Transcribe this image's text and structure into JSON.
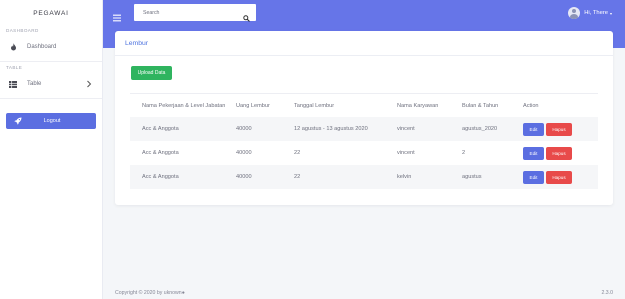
{
  "sidebar": {
    "brand": "PEGAWAI",
    "heading_dashboard": "DASHBOARD",
    "dashboard_label": "Dashboard",
    "heading_table": "TABLE",
    "table_label": "Table",
    "logout_label": "Logout"
  },
  "topbar": {
    "search_placeholder": "Search",
    "user_name": "Hi, There",
    "caret": "▾"
  },
  "card": {
    "title": "Lembur",
    "upload_label": "Upload Data"
  },
  "table": {
    "headers": [
      "Nama Pekerjaan & Level Jabatan",
      "Uang Lembur",
      "Tanggal Lembur",
      "Nama Karyawan",
      "Bulan & Tahun",
      "Action"
    ],
    "rows": [
      [
        "Acc & Anggota",
        "40000",
        "12 agustus - 13 agustus 2020",
        "vincent",
        "agustus_2020"
      ],
      [
        "Acc & Anggota",
        "40000",
        "22",
        "vincent",
        "2"
      ],
      [
        "Acc & Anggota",
        "40000",
        "22",
        "kelvin",
        "agustus"
      ]
    ],
    "edit_label": "Edit",
    "delete_label": "Hapus"
  },
  "footer": {
    "copyright": "Copyright © 2020  by uknown●",
    "version": "2.3.0"
  },
  "colors": {
    "topbar": "#6675e8",
    "primary": "#5b6ee1",
    "success": "#2fb45f",
    "danger": "#e84a4a",
    "link": "#4e73df"
  },
  "icons": {
    "dashboard": "fire-icon",
    "table": "table-icon",
    "logout": "rocket-icon",
    "menu": "hamburger-icon",
    "search": "search-icon"
  }
}
